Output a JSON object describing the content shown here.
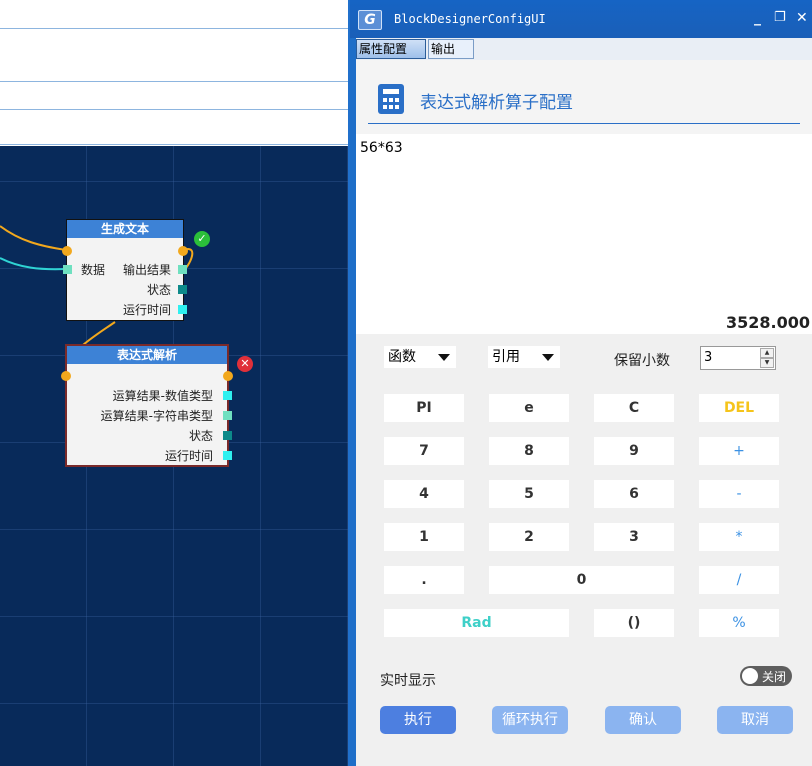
{
  "canvas": {
    "node1": {
      "title": "生成文本",
      "input": "数据",
      "outputs": [
        "输出结果",
        "状态",
        "运行时间"
      ],
      "status_icon": "check-icon"
    },
    "node2": {
      "title": "表达式解析",
      "outputs": [
        "运算结果-数值类型",
        "运算结果-字符串类型",
        "状态",
        "运行时间"
      ],
      "status_icon": "error-icon"
    }
  },
  "dialog": {
    "title": "BlockDesignerConfigUI",
    "tabs": [
      "属性配置",
      "输出"
    ],
    "header_title": "表达式解析算子配置",
    "expression": "56*63",
    "result": "3528.000",
    "function_dropdown": "函数",
    "reference_dropdown": "引用",
    "decimals_label": "保留小数",
    "decimals_value": "3",
    "keys": [
      "PI",
      "e",
      "C",
      "DEL",
      "7",
      "8",
      "9",
      "+",
      "4",
      "5",
      "6",
      "-",
      "1",
      "2",
      "3",
      "*",
      ".",
      "0",
      "/",
      "Rad",
      "()",
      "%"
    ],
    "realtime_label": "实时显示",
    "toggle_label": "关闭",
    "buttons": {
      "execute": "执行",
      "loop": "循环执行",
      "confirm": "确认",
      "cancel": "取消"
    },
    "colors": {
      "accent": "#2a6fc7",
      "title_bar": "#1664c4",
      "del_key": "#f5c41a",
      "rad_key": "#3fd0c8",
      "op_key": "#3b91e3"
    }
  }
}
